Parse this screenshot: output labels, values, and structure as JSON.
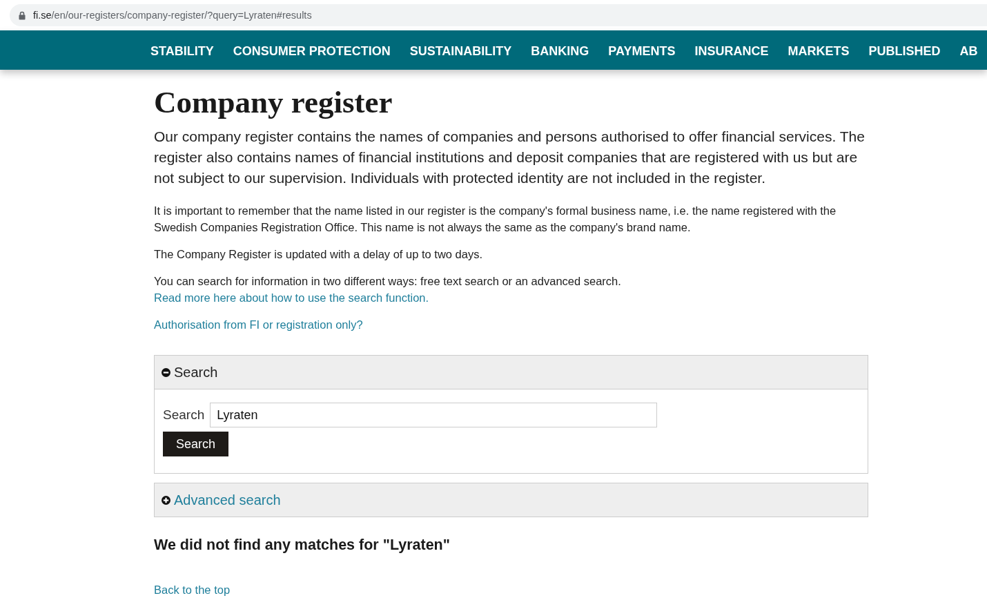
{
  "browser": {
    "address_bar": {
      "host": "fi.se",
      "path": "/en/our-registers/company-register/?query=Lyraten#results"
    }
  },
  "nav": {
    "items": [
      "STABILITY",
      "CONSUMER PROTECTION",
      "SUSTAINABILITY",
      "BANKING",
      "PAYMENTS",
      "INSURANCE",
      "MARKETS",
      "PUBLISHED",
      "AB"
    ]
  },
  "page": {
    "title": "Company register",
    "lead": "Our company register contains the names of companies and persons authorised to offer financial services. The register also contains names of financial institutions and deposit companies that are registered with us but are not subject to our supervision. Individuals with protected identity are not included in the register.",
    "blocks": [
      {
        "kind": "paragraph",
        "text": "It is important to remember that the name listed in our register is the company's formal business name, i.e. the name registered with the Swedish Companies Registration Office. This name is not always the same as the company's brand name."
      },
      {
        "kind": "paragraph",
        "text": "The Company Register is updated with a delay of up to two days."
      },
      {
        "kind": "paragraph",
        "text": "You can search for information in two different ways: free text search or an advanced search.",
        "link": "Read more here about how to use the search function."
      },
      {
        "kind": "link",
        "text": "Authorisation from FI or registration only?"
      }
    ]
  },
  "search_panels": [
    {
      "title": "Search",
      "expanded": true,
      "form": {
        "label": "Search",
        "value": "Lyraten",
        "button": "Search"
      }
    },
    {
      "title": "Advanced search",
      "expanded": false
    }
  ],
  "result": {
    "message": "We did not find any matches for \"Lyraten\"",
    "back_link": "Back to the top"
  }
}
